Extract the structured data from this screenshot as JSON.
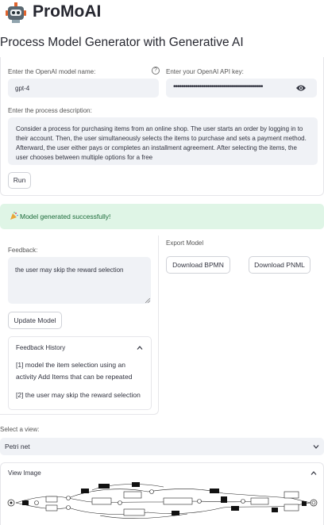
{
  "app": {
    "title": "ProMoAI",
    "logo_icon": "robot-icon"
  },
  "page": {
    "title": "Process Model Generator with Generative AI"
  },
  "form": {
    "model_label": "Enter the OpenAI model name:",
    "model_value": "gpt-4",
    "api_key_label": "Enter your OpenAI API key:",
    "api_key_value": "•••••••••••••••••••••••••••••••••••••••••••••",
    "description_label": "Enter the process description:",
    "description_value": "Consider a process for purchasing items from an online shop. The user starts an order by logging in to their account. Then, the user simultaneously selects the items to purchase and sets a payment method. Afterward, the user either pays or completes an installment agreement. After selecting the items, the user chooses between multiple options for a free",
    "run_label": "Run"
  },
  "status": {
    "success_message": "Model generated successfully!",
    "icon": "party-icon",
    "color": "#dff5e6"
  },
  "feedback": {
    "label": "Feedback:",
    "value": "the user may skip the reward selection",
    "update_label": "Update Model",
    "history_title": "Feedback History",
    "history": [
      "[1] model the item selection using an activity Add Items that can be repeated",
      "[2] the user may skip the reward selection"
    ]
  },
  "export": {
    "label": "Export Model",
    "bpmn_label": "Download BPMN",
    "pnml_label": "Download PNML"
  },
  "view": {
    "label": "Select a view:",
    "selected": "Petri net",
    "image_title": "View Image"
  }
}
